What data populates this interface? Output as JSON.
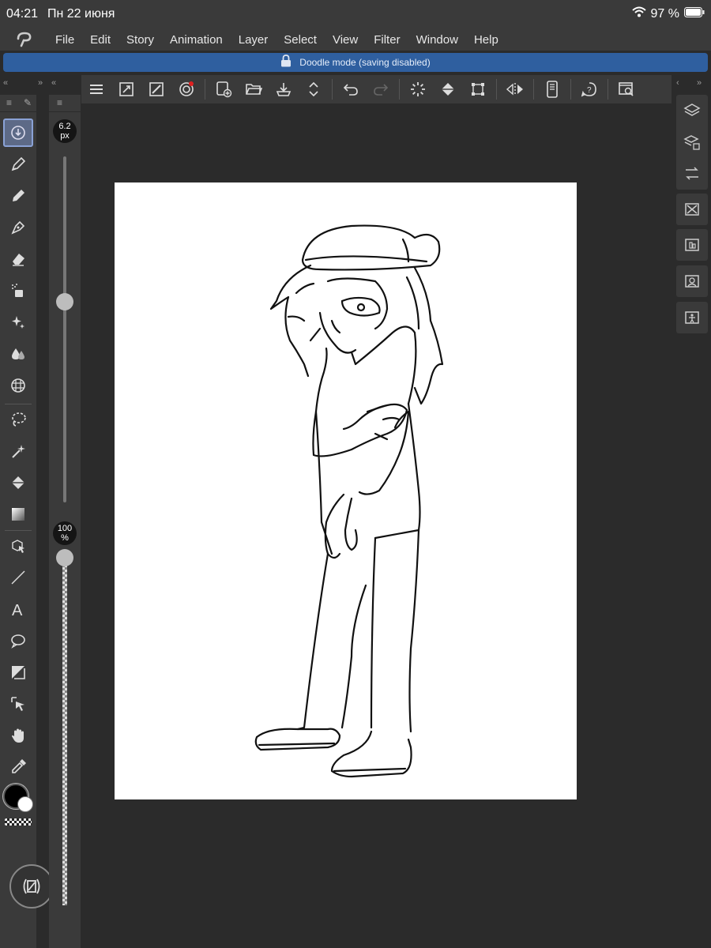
{
  "status_bar": {
    "time": "04:21",
    "date": "Пн 22 июня",
    "battery": "97 %"
  },
  "menu": [
    "File",
    "Edit",
    "Story",
    "Animation",
    "Layer",
    "Select",
    "View",
    "Filter",
    "Window",
    "Help"
  ],
  "banner": {
    "text": "Doodle mode (saving disabled)"
  },
  "brush_size": {
    "value": "6.2",
    "unit": "px",
    "level": 0.58
  },
  "opacity": {
    "value": "100",
    "unit": "%",
    "level": 1.0
  },
  "toolbar_icons": [
    "menu-icon",
    "resize-icon",
    "brush-settings-icon",
    "spiral-icon",
    "new-file-icon",
    "open-folder-icon",
    "export-icon",
    "up-down-icon",
    "undo-icon",
    "redo-icon",
    "loading-icon",
    "fill-icon",
    "transform-icon",
    "flip-icon",
    "phone-icon",
    "help-icon",
    "search-window-icon"
  ],
  "left_tools": [
    "sub-tool-icon",
    "pen-icon",
    "pencil-icon",
    "fountain-pen-icon",
    "eraser-icon",
    "airbrush-icon",
    "sparkle-icon",
    "blend-icon",
    "grid-icon",
    "lasso-icon",
    "magic-wand-icon",
    "bucket-icon",
    "gradient-icon",
    "object-select-icon",
    "line-icon",
    "text-icon",
    "balloon-icon",
    "frame-border-icon",
    "move-arrow-icon",
    "hand-icon",
    "eyedropper-icon"
  ],
  "right_panel_icons": [
    "layers-icon",
    "layer-property-icon",
    "history-icon",
    "material-icon",
    "material-folder-icon",
    "material-person-icon",
    "material-figure-icon"
  ],
  "colors": {
    "main": "#000000",
    "sub": "#ffffff",
    "accent": "#2f5f9f"
  }
}
